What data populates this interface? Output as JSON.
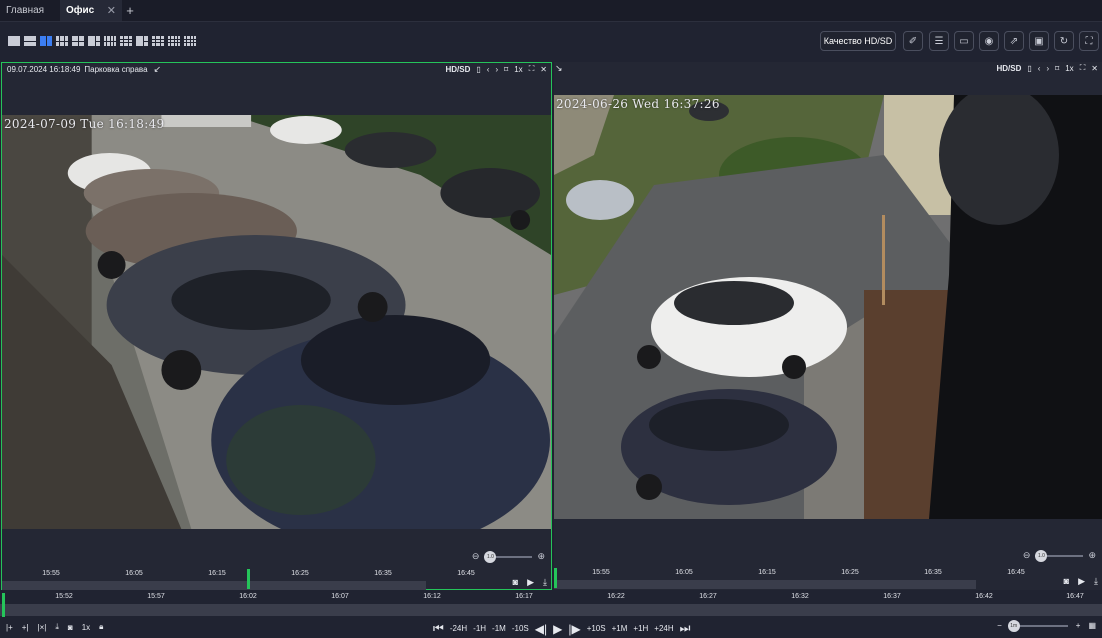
{
  "tabs": [
    {
      "label": "Главная",
      "active": false
    },
    {
      "label": "Офис",
      "active": true
    }
  ],
  "toolbar": {
    "quality_label": "Качество HD/SD",
    "layout_icons": [
      "layout-1x1-icon",
      "layout-1x2-icon",
      "layout-2x1-icon",
      "layout-3plus2-icon",
      "layout-2x2-icon",
      "layout-1plus2-icon",
      "layout-2x4-icon",
      "layout-3x3-icon",
      "layout-3x4-icon",
      "layout-4x4-icon"
    ],
    "selected_layout": 2,
    "tool_icons": [
      "brush-icon",
      "list-icon",
      "monitor-icon",
      "eye-icon",
      "export-icon",
      "picture-icon",
      "refresh-icon",
      "fullscreen-icon"
    ]
  },
  "cameras": [
    {
      "header_datetime": "09.07.2024 16:18:49",
      "header_name": "Парковка справа",
      "quality": "HD/SD",
      "speed": "1x",
      "osd": "2024-07-09 Tue 16:18:49",
      "zoom": "1.0",
      "timeline_ticks": [
        "15:55",
        "16:05",
        "16:15",
        "16:25",
        "16:35",
        "16:45"
      ]
    },
    {
      "quality": "HD/SD",
      "speed": "1x",
      "osd": "2024-06-26 Wed 16:37:26",
      "zoom": "1.0",
      "timeline_ticks": [
        "15:55",
        "16:05",
        "16:15",
        "16:25",
        "16:35",
        "16:45"
      ]
    }
  ],
  "main_timeline": {
    "ticks": [
      "15:52",
      "15:57",
      "16:02",
      "16:07",
      "16:12",
      "16:17",
      "16:22",
      "16:27",
      "16:32",
      "16:37",
      "16:42",
      "16:47"
    ]
  },
  "controls": {
    "speed": "1x",
    "minus_24h": "-24H",
    "minus_1h": "-1H",
    "minus_1m": "-1M",
    "minus_10s": "-10S",
    "plus_10s": "+10S",
    "plus_1m": "+1M",
    "plus_1h": "+1H",
    "plus_24h": "+24H",
    "zoom_value": "1m"
  },
  "colors": {
    "accent": "#3c7ef3",
    "selected_border": "#25c45a",
    "background": "#202331"
  }
}
